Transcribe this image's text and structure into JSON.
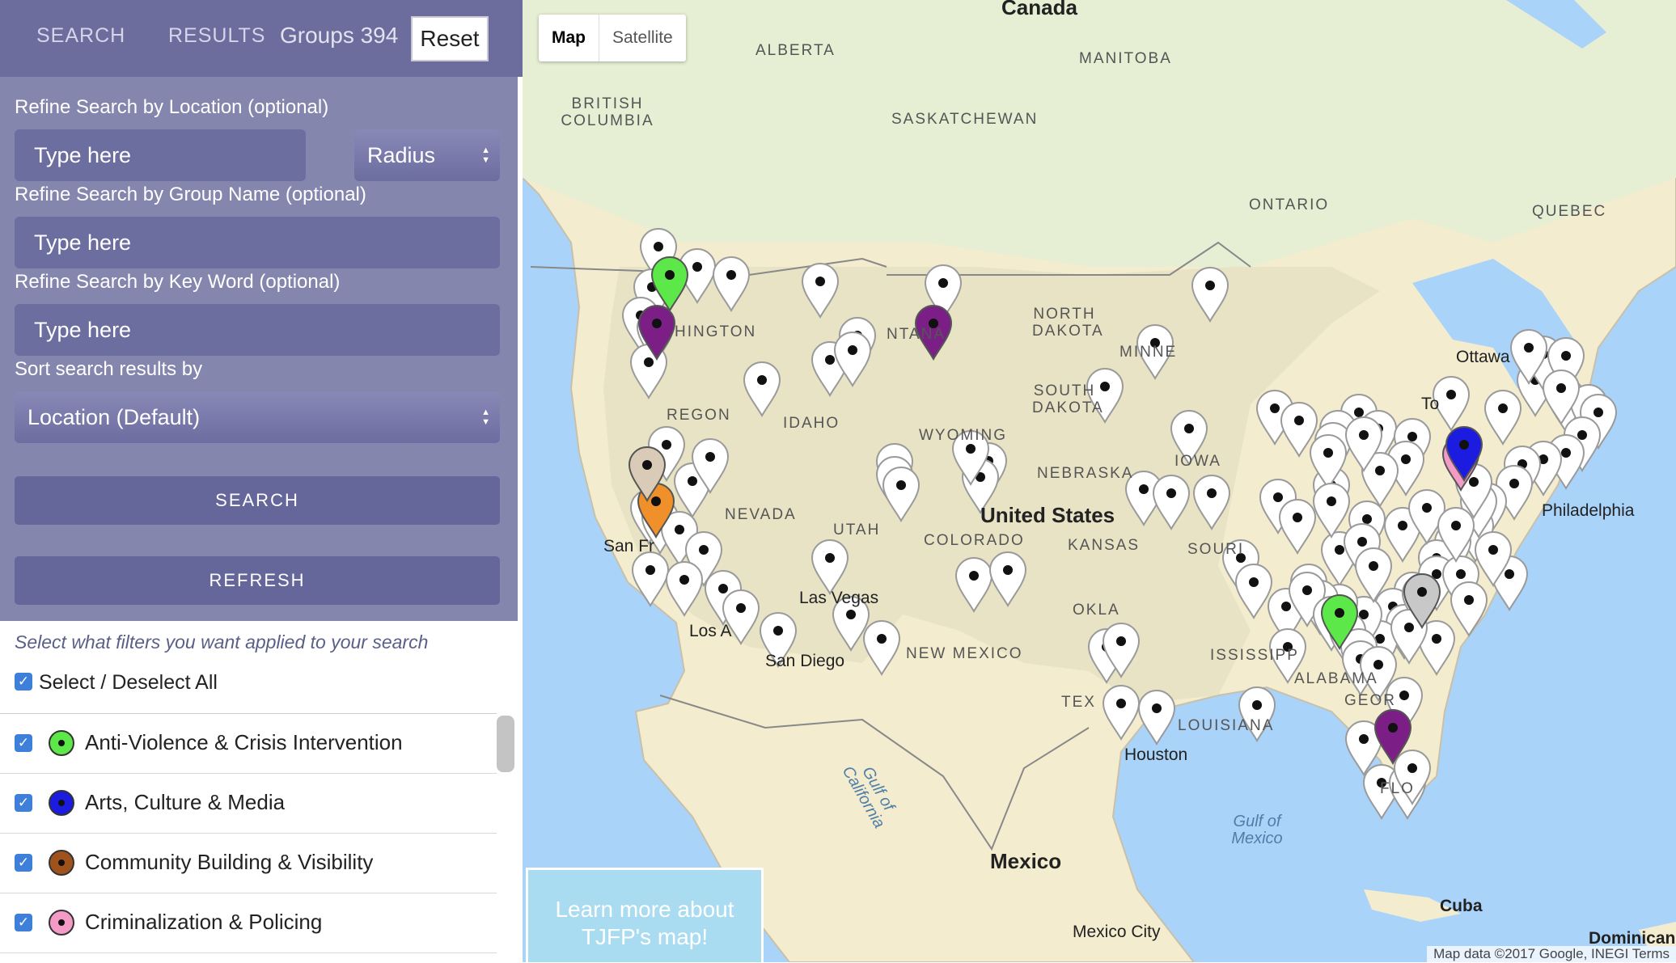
{
  "tabs": {
    "search": "SEARCH",
    "results": "RESULTS",
    "groups": "Groups 394",
    "reset": "Reset"
  },
  "form": {
    "location_label": "Refine Search by Location (optional)",
    "location_placeholder": "Type here",
    "radius_label": "Radius",
    "group_label": "Refine Search by Group Name (optional)",
    "group_placeholder": "Type here",
    "keyword_label": "Refine Search by Key Word (optional)",
    "keyword_placeholder": "Type here",
    "sort_label": "Sort search results by",
    "sort_value": "Location (Default)",
    "search_button": "SEARCH",
    "refresh_button": "REFRESH"
  },
  "filters": {
    "hint": "Select what filters you want applied to your search",
    "select_all": "Select / Deselect All",
    "items": [
      {
        "label": "Anti-Violence & Crisis Intervention",
        "color": "#5de84a"
      },
      {
        "label": "Arts, Culture & Media",
        "color": "#1c1ce0"
      },
      {
        "label": "Community Building & Visibility",
        "color": "#a0521d"
      },
      {
        "label": "Criminalization & Policing",
        "color": "#f49ac6"
      }
    ]
  },
  "map": {
    "type_map": "Map",
    "type_satellite": "Satellite",
    "learn_more": "Learn more about TJFP's map!",
    "attribution": "Map data ©2017 Google, INEGI  Terms",
    "regions": {
      "alberta": "ALBERTA",
      "british_columbia": "BRITISH COLUMBIA",
      "manitoba": "MANITOBA",
      "saskatchewan": "SASKATCHEWAN",
      "ontario": "ONTARIO",
      "quebec": "QUEBEC",
      "north_dakota": "NORTH DAKOTA",
      "south_dakota": "SOUTH DAKOTA",
      "montana": "NTANA",
      "washington": "HINGTON",
      "oregon": "REGON",
      "idaho": "IDAHO",
      "wyoming": "WYOMING",
      "nebraska": "NEBRASKA",
      "nevada": "NEVADA",
      "utah": "UTAH",
      "colorado": "COLORADO",
      "kansas": "KANSAS",
      "iowa": "IOWA",
      "minnesota": "MINNE",
      "missouri": "SOURI",
      "oklahoma": "OKLA",
      "new_mexico": "NEW MEXICO",
      "texas": "TEX",
      "louisiana": "LOUISIANA",
      "alabama": "ALABAMA",
      "mississippi": "ISSISSIPP",
      "georgia": "GEOR",
      "florida": "FLO"
    },
    "places": {
      "canada": "Canada",
      "united_states": "United States",
      "mexico": "Mexico",
      "ottawa": "Ottawa",
      "toronto": "To",
      "philadelphia": "Philadelphia",
      "houston": "Houston",
      "san_diego": "San Diego",
      "las_vegas": "Las Vegas",
      "los_angeles": "Los A",
      "san_francisco": "San Fr",
      "mexico_city": "Mexico City",
      "cuba": "Cuba",
      "dominican": "Dominican",
      "gulf_california": "Gulf of California",
      "gulf_mexico": "Gulf of Mexico"
    }
  }
}
